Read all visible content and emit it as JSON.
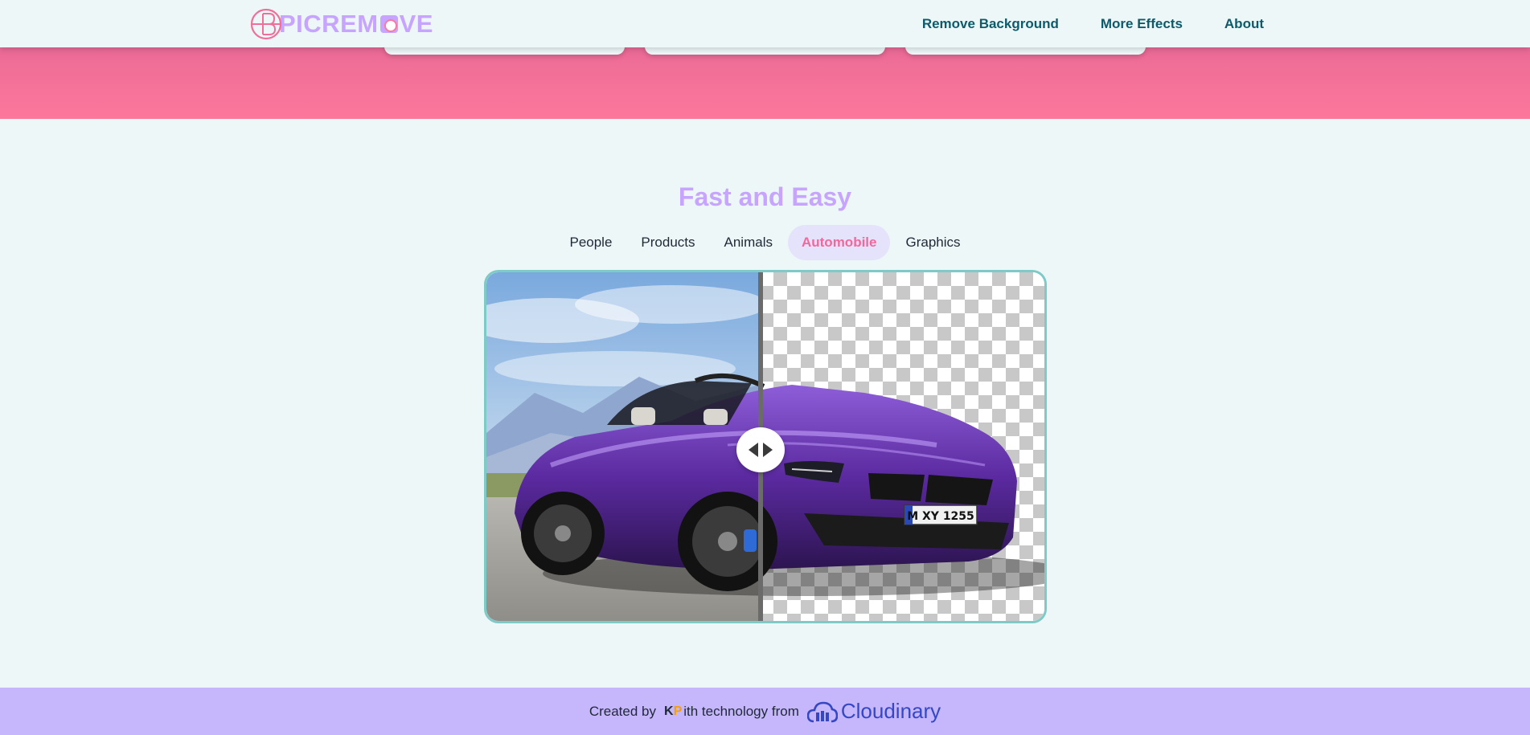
{
  "header": {
    "logo_text": "PICREM",
    "logo_text_end": "VE",
    "nav": [
      {
        "label": "Remove Background"
      },
      {
        "label": "More Effects"
      },
      {
        "label": "About"
      }
    ]
  },
  "section": {
    "title": "Fast and Easy",
    "tabs": [
      {
        "label": "People",
        "active": false
      },
      {
        "label": "Products",
        "active": false
      },
      {
        "label": "Animals",
        "active": false
      },
      {
        "label": "Automobile",
        "active": true
      },
      {
        "label": "Graphics",
        "active": false
      }
    ],
    "compare": {
      "plate_text": "M XY 1255",
      "split_fraction": 0.49
    }
  },
  "footer": {
    "created_by": "Created by",
    "kp_k": "K",
    "kp_p": "P",
    "with_tech": "ith technology from",
    "brand": "Cloudinary"
  },
  "colors": {
    "accent_purple": "#c7a4ff",
    "accent_pink": "#f4679b",
    "nav_text": "#0c5b6b",
    "footer_bg": "#c6b6fb",
    "frame_teal": "#7ecac6"
  }
}
